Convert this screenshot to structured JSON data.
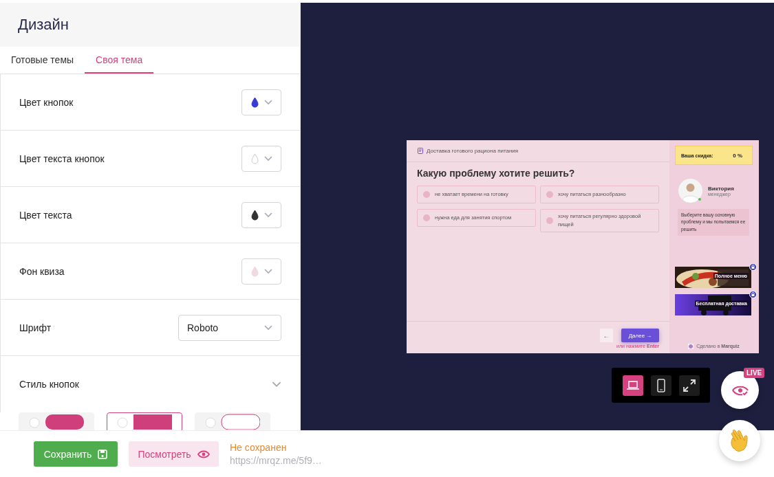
{
  "panel": {
    "title": "Дизайн",
    "tabs": [
      {
        "label": "Готовые темы",
        "selected": false
      },
      {
        "label": "Своя тема",
        "selected": true
      }
    ],
    "settings": [
      {
        "kind": "color",
        "label": "Цвет кнопок",
        "color": "#3a3ad6"
      },
      {
        "kind": "color",
        "label": "Цвет текста кнопок",
        "color": "#ffffff"
      },
      {
        "kind": "color",
        "label": "Цвет текста",
        "color": "#333333"
      },
      {
        "kind": "color",
        "label": "Фон квиза",
        "color": "#f2d9e1"
      },
      {
        "kind": "select",
        "label": "Шрифт",
        "value": "Roboto"
      },
      {
        "kind": "collapse",
        "label": "Стиль кнопок",
        "expanded": true
      }
    ],
    "button_styles": [
      {
        "kind": "filled",
        "selected": false
      },
      {
        "kind": "square",
        "selected": true
      },
      {
        "kind": "outline",
        "selected": false
      }
    ]
  },
  "preview": {
    "header": "Доставка готового рациона питания",
    "question": "Какую проблему хотите решить?",
    "options": [
      {
        "label": "не хватает времени на готовку",
        "selected": false
      },
      {
        "label": "хочу питаться разнообразно",
        "selected": false
      },
      {
        "label": "нужна еда для занятия спортом",
        "selected": false
      },
      {
        "label": "хочу питаться регулярно здоровой пищей",
        "selected": false
      }
    ],
    "back_button": "←",
    "next_button": "Далее →",
    "hint": "или нажмите **Enter**",
    "discount_label": "Ваша скидка:",
    "discount_value": "0 %",
    "manager_name": "Виктория",
    "manager_role": "менеджер",
    "manager_message": "Выберите вашу основную проблему и мы попытаемся ее решить",
    "bonuses": [
      "Полное меню",
      "Бесплатная доставка"
    ],
    "made_with": "Сделано в **Marquiz**"
  },
  "devices": [
    {
      "kind": "desktop",
      "selected": true
    },
    {
      "kind": "mobile",
      "selected": false
    },
    {
      "kind": "fullscreen",
      "selected": false
    }
  ],
  "live_badge": "LIVE",
  "footer": {
    "save_button": "Сохранить",
    "preview_button": "Посмотреть",
    "status": "Не сохранен",
    "link": "https://mrqz.me/5f9…"
  }
}
